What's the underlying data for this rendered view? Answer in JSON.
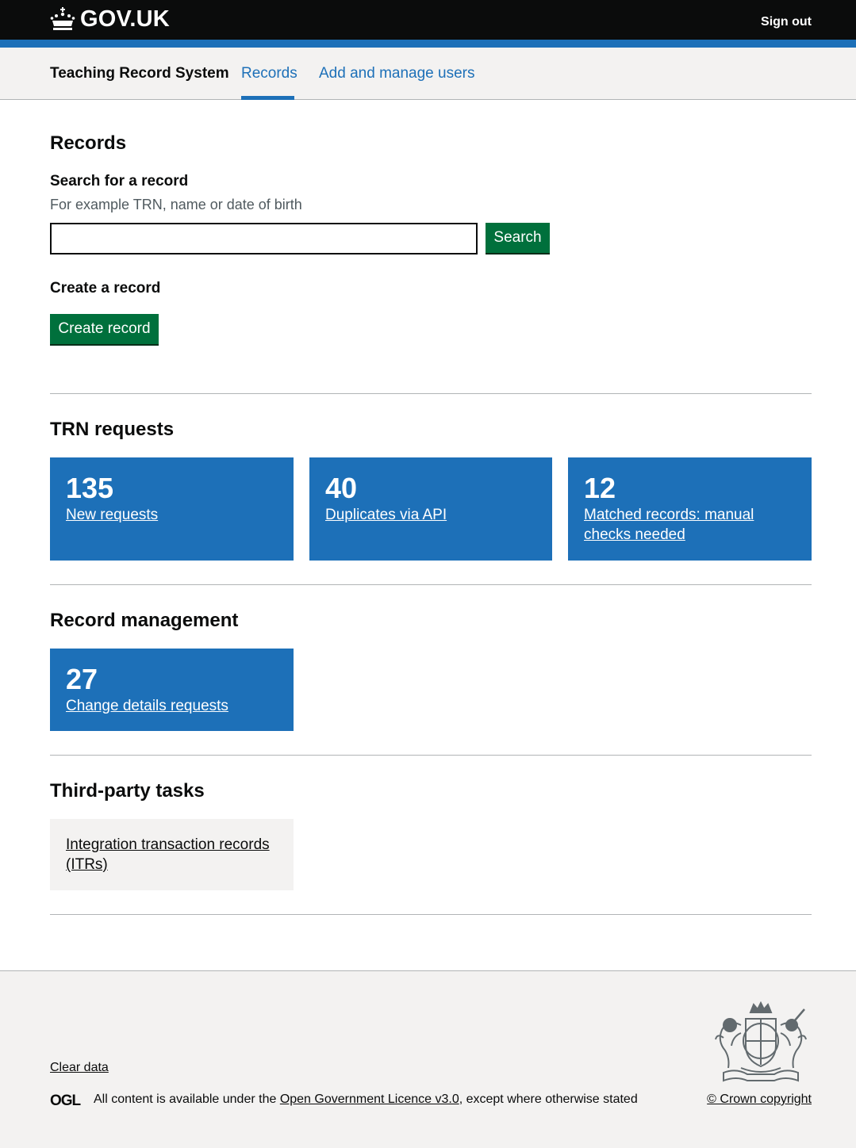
{
  "header": {
    "logo_text": "GOV.UK",
    "sign_out": "Sign out"
  },
  "service_nav": {
    "service_name": "Teaching Record System",
    "items": [
      {
        "label": "Records",
        "active": true
      },
      {
        "label": "Add and manage users",
        "active": false
      }
    ]
  },
  "records": {
    "heading": "Records",
    "search_label": "Search for a record",
    "search_hint": "For example TRN, name or date of birth",
    "search_value": "",
    "search_button": "Search",
    "create_label": "Create a record",
    "create_button": "Create record"
  },
  "trn_requests": {
    "heading": "TRN requests",
    "tiles": [
      {
        "count": "135",
        "link": "New requests"
      },
      {
        "count": "40",
        "link": "Duplicates via API"
      },
      {
        "count": "12",
        "link": "Matched records: manual checks needed"
      }
    ]
  },
  "record_management": {
    "heading": "Record management",
    "tiles": [
      {
        "count": "27",
        "link": "Change details requests"
      }
    ]
  },
  "third_party": {
    "heading": "Third-party tasks",
    "tiles": [
      {
        "link": "Integration transaction records (ITRs)"
      }
    ]
  },
  "footer": {
    "clear_data": "Clear data",
    "ogl_label": "OGL",
    "licence_prefix": "All content is available under the ",
    "licence_link": "Open Government Licence v3.0",
    "licence_suffix": ", except where otherwise stated",
    "copyright": "© Crown copyright"
  },
  "colors": {
    "header_bg": "#0b0c0c",
    "brand_blue": "#1d70b8",
    "button_green": "#00703c",
    "footer_bg": "#f3f2f1"
  }
}
